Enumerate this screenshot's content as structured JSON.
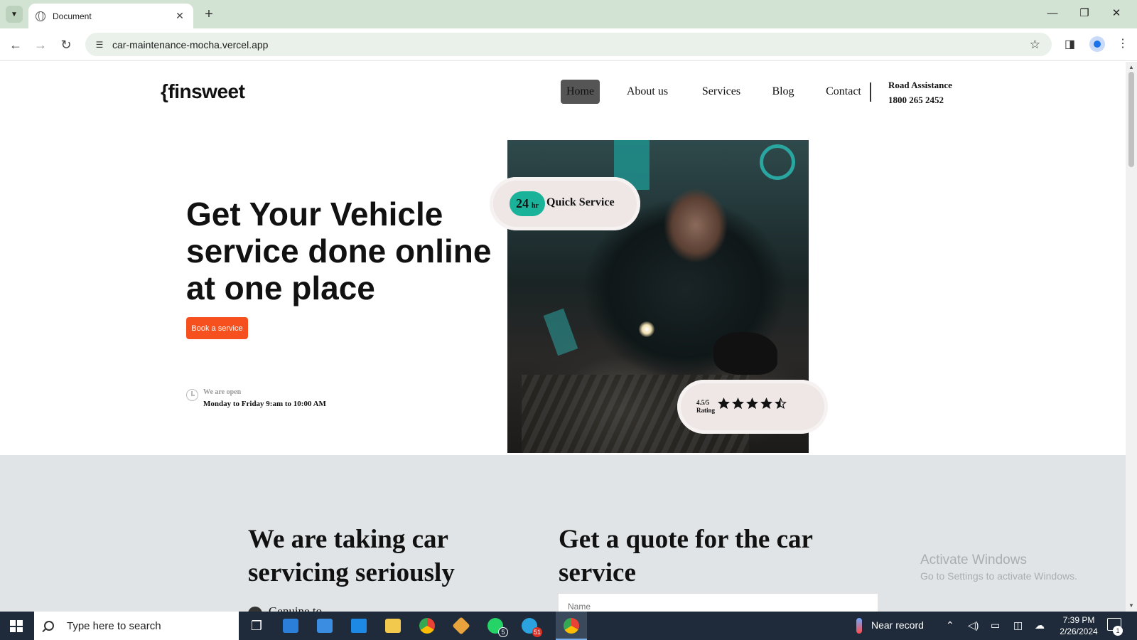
{
  "browser": {
    "tab_title": "Document",
    "tab_close": "✕",
    "new_tab": "+",
    "url": "car-maintenance-mocha.vercel.app",
    "minimize": "—",
    "restore": "❐",
    "close": "✕"
  },
  "site": {
    "logo": "{finsweet",
    "nav": [
      "Home",
      "About us",
      "Services",
      "Blog",
      "Contact"
    ],
    "active_nav": "Home",
    "road_assistance_label": "Road Assistance",
    "road_assistance_phone": "1800 265 2452"
  },
  "hero": {
    "title": "Get Your Vehicle service done online at one place",
    "cta": "Book a service",
    "open_label": "We are open",
    "open_hours": "Monday to Friday 9:am to 10:00 AM",
    "badge_number": "24",
    "badge_unit": "hr",
    "badge_text": "Quick Service",
    "rating_score": "4.5/5",
    "rating_label": "Rating",
    "rating_value": 4.5,
    "rating_max": 5
  },
  "section2": {
    "left_title": "We are taking car servicing seriously",
    "right_title": "Get a quote for the car service",
    "name_placeholder": "Name",
    "bullet_text": "Genuine to ..."
  },
  "watermark": {
    "line1": "Activate Windows",
    "line2": "Go to Settings to activate Windows."
  },
  "taskbar": {
    "search_placeholder": "Type here to search",
    "whatsapp_count": "5",
    "telegram_count": "51",
    "weather": "Near record",
    "time": "7:39 PM",
    "date": "2/26/2024",
    "notifications": "1"
  },
  "colors": {
    "accent_orange": "#f5501d",
    "teal_badge": "#1ab39a",
    "nav_active_bg": "#555555",
    "section_bg": "#e0e4e6"
  }
}
